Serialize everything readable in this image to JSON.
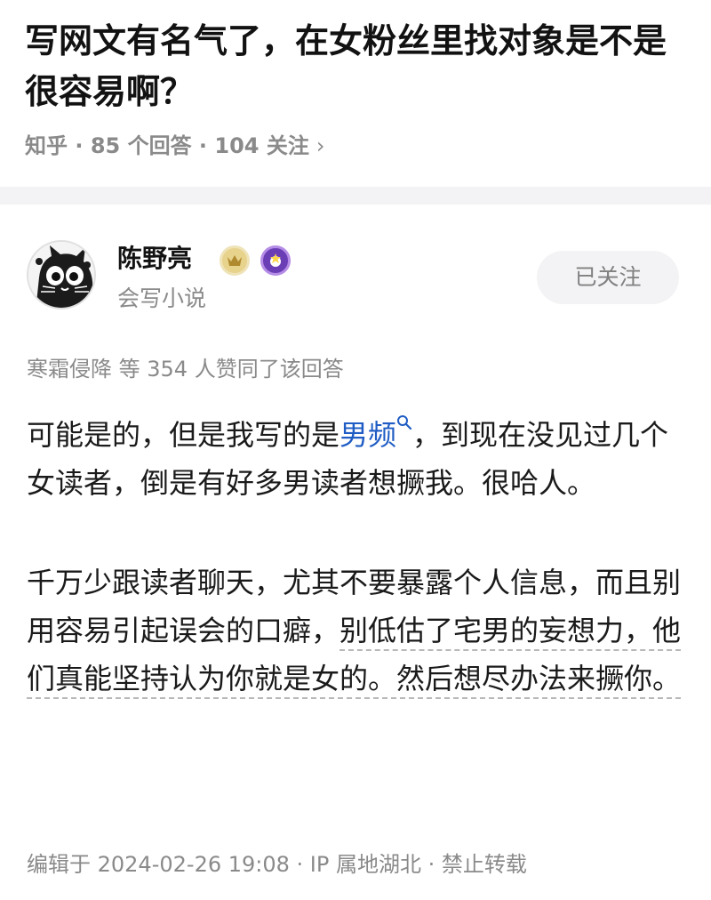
{
  "question": {
    "title": "写网文有名气了，在女粉丝里找对象是不是很容易啊？",
    "meta": "知乎 · 85 个回答 · 104 关注",
    "meta_chevron": "›"
  },
  "author": {
    "name": "陈野亮",
    "bio": "会写小说",
    "follow_label": "已关注",
    "badges": [
      "crown-badge-icon",
      "purple-star-badge-icon"
    ]
  },
  "answer": {
    "vote_summary": "寒霜侵降 等 354 人赞同了该回答",
    "p1_before": "可能是的，但是我写的是",
    "p1_link": "男频",
    "p1_after": "，到现在没见过几个女读者，倒是有好多男读者想撅我。很哈人。",
    "p2_before": "千万少跟读者聊天，尤其不要暴露个人信息，而且别用容易引起误会的口癖，",
    "p2_underlined": "别低估了宅男的妄想力，他们真能坚持认为你就是女的。然后想尽办法来撅你。",
    "footer": "编辑于 2024-02-26 19:08 · IP 属地湖北 · 禁止转载"
  },
  "colors": {
    "link": "#1f5cc4",
    "muted": "#8a8a8a",
    "follow_bg": "#f3f3f5"
  }
}
